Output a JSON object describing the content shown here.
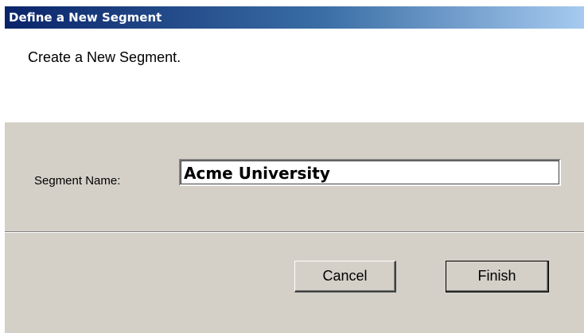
{
  "window": {
    "title": "Define a New Segment"
  },
  "header": {
    "text": "Create a New Segment."
  },
  "form": {
    "segment_name_label": "Segment Name:",
    "segment_name_value": "Acme University"
  },
  "buttons": {
    "cancel_label": "Cancel",
    "finish_label": "Finish"
  },
  "colors": {
    "titlebar_start": "#0a246a",
    "titlebar_end": "#a6caf0",
    "dialog_face": "#d4d0c8",
    "header_panel": "#ffffff"
  }
}
